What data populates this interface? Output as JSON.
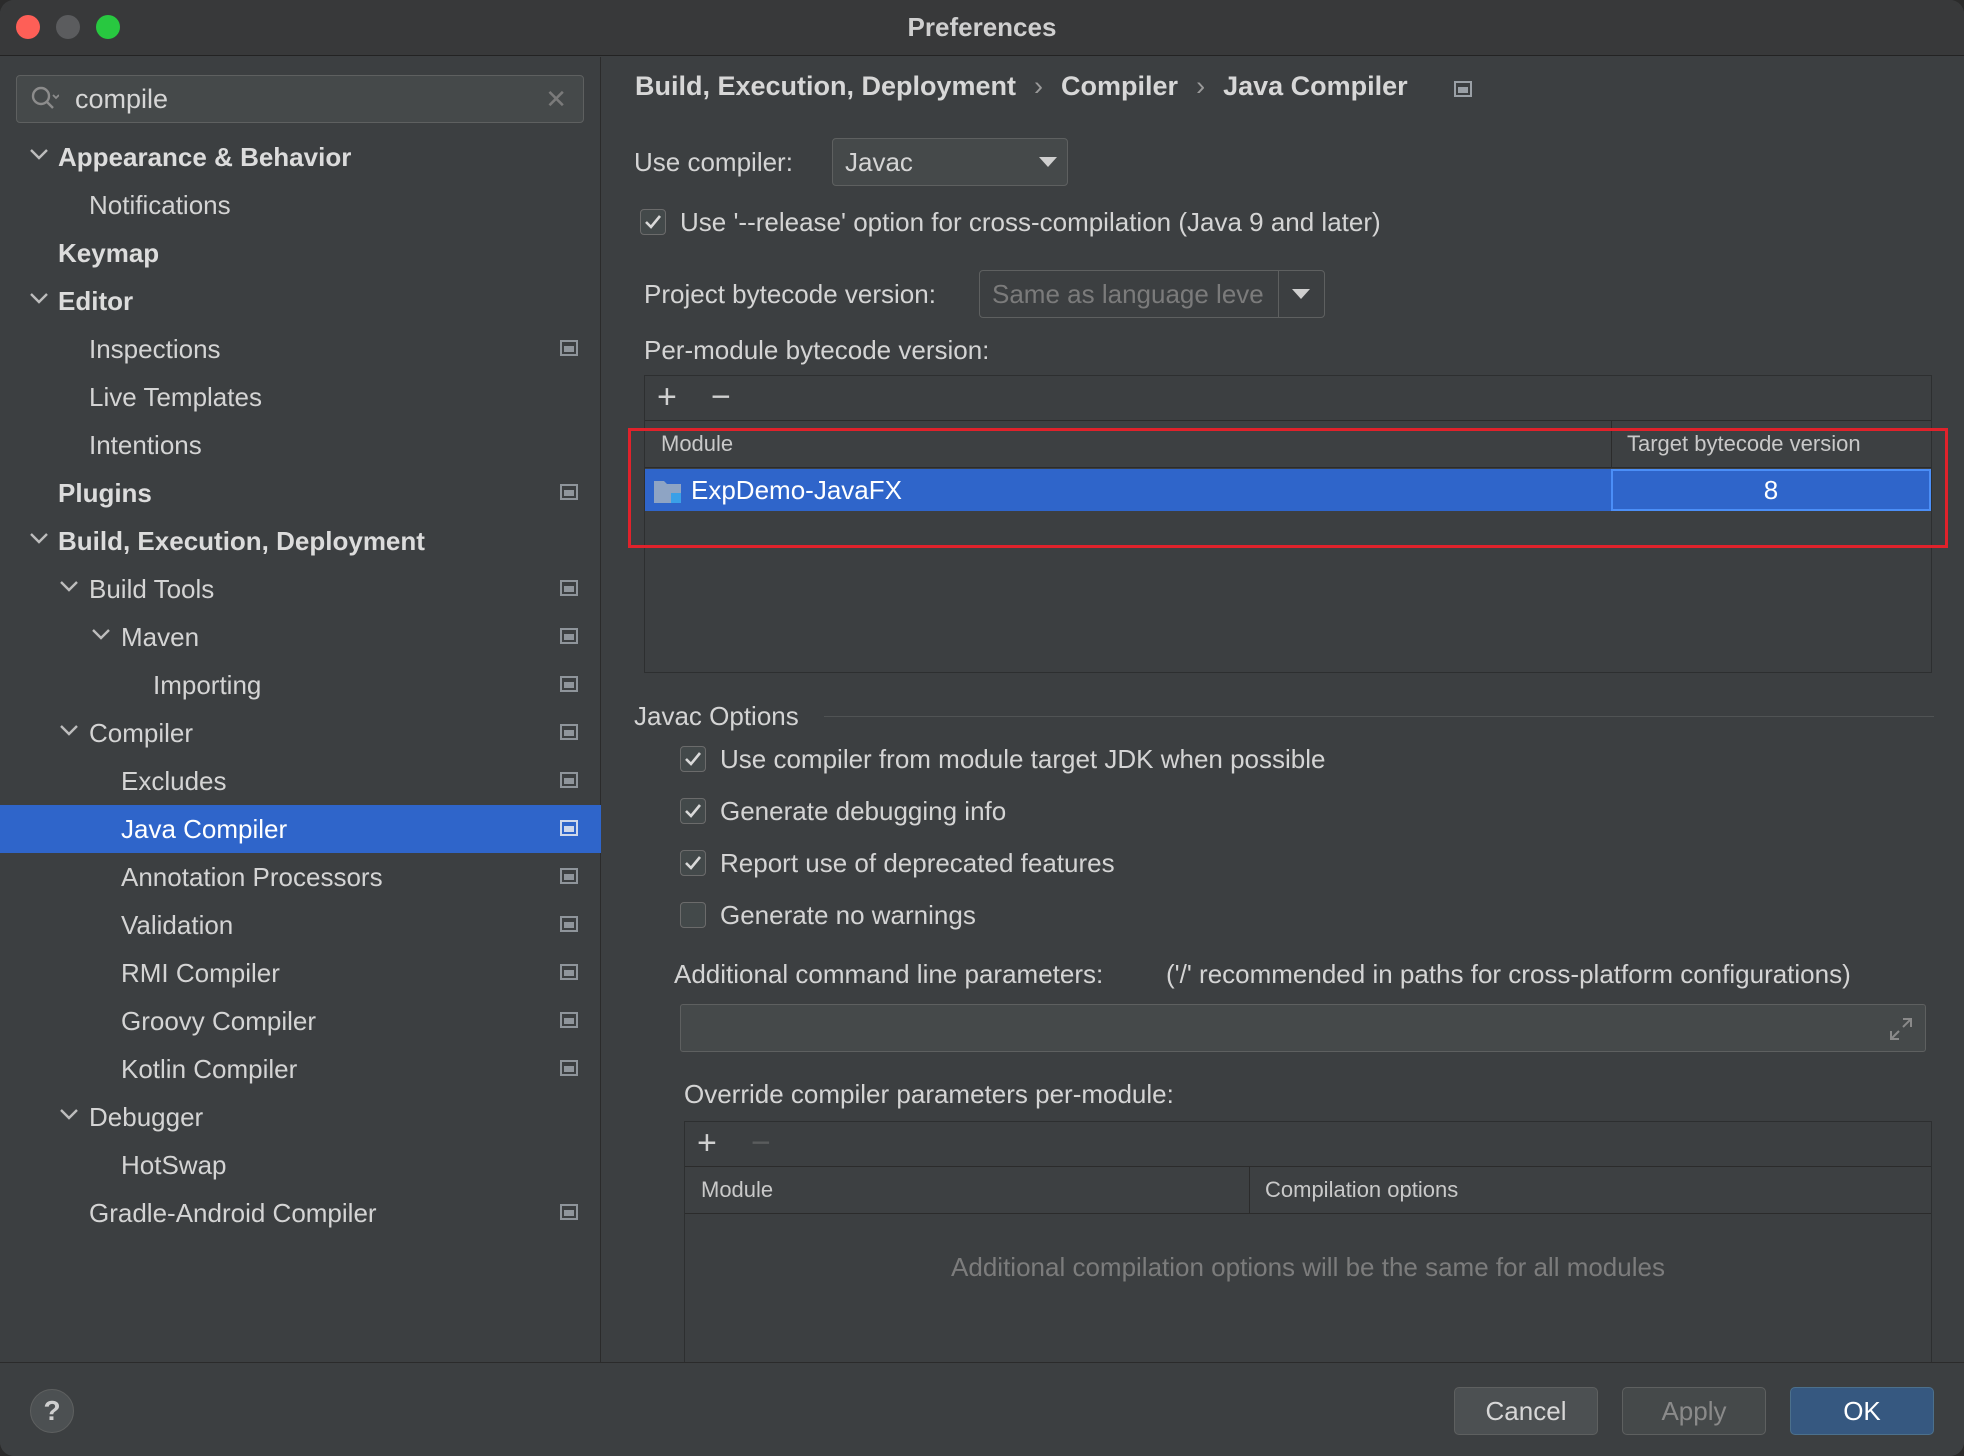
{
  "window": {
    "title": "Preferences"
  },
  "search": {
    "value": "compile"
  },
  "sidebar": {
    "items": [
      {
        "label": "Appearance & Behavior",
        "bold": true,
        "level": 0,
        "expanded": true,
        "project": false
      },
      {
        "label": "Notifications",
        "bold": false,
        "level": 1,
        "project": false
      },
      {
        "label": "Keymap",
        "bold": true,
        "level": 0,
        "project": false
      },
      {
        "label": "Editor",
        "bold": true,
        "level": 0,
        "expanded": true,
        "project": false
      },
      {
        "label": "Inspections",
        "bold": false,
        "level": 1,
        "project": true
      },
      {
        "label": "Live Templates",
        "bold": false,
        "level": 1,
        "project": false
      },
      {
        "label": "Intentions",
        "bold": false,
        "level": 1,
        "project": false
      },
      {
        "label": "Plugins",
        "bold": true,
        "level": 0,
        "project": true
      },
      {
        "label": "Build, Execution, Deployment",
        "bold": true,
        "level": 0,
        "expanded": true,
        "project": false
      },
      {
        "label": "Build Tools",
        "bold": false,
        "level": 1,
        "expanded": true,
        "project": true
      },
      {
        "label": "Maven",
        "bold": false,
        "level": 2,
        "expanded": true,
        "project": true
      },
      {
        "label": "Importing",
        "bold": false,
        "level": 3,
        "project": true
      },
      {
        "label": "Compiler",
        "bold": false,
        "level": 1,
        "expanded": true,
        "project": true
      },
      {
        "label": "Excludes",
        "bold": false,
        "level": 2,
        "project": true
      },
      {
        "label": "Java Compiler",
        "bold": false,
        "level": 2,
        "project": true,
        "selected": true
      },
      {
        "label": "Annotation Processors",
        "bold": false,
        "level": 2,
        "project": true
      },
      {
        "label": "Validation",
        "bold": false,
        "level": 2,
        "project": true
      },
      {
        "label": "RMI Compiler",
        "bold": false,
        "level": 2,
        "project": true
      },
      {
        "label": "Groovy Compiler",
        "bold": false,
        "level": 2,
        "project": true
      },
      {
        "label": "Kotlin Compiler",
        "bold": false,
        "level": 2,
        "project": true
      },
      {
        "label": "Debugger",
        "bold": false,
        "level": 1,
        "expanded": true,
        "project": false
      },
      {
        "label": "HotSwap",
        "bold": false,
        "level": 2,
        "project": false
      },
      {
        "label": "Gradle-Android Compiler",
        "bold": false,
        "level": 1,
        "project": true
      }
    ]
  },
  "breadcrumb": {
    "part1": "Build, Execution, Deployment",
    "part2": "Compiler",
    "part3": "Java Compiler",
    "separator": "›"
  },
  "compiler": {
    "use_compiler_label": "Use compiler:",
    "use_compiler_value": "Javac",
    "release_option_label": "Use '--release' option for cross-compilation (Java 9 and later)",
    "release_option_checked": true,
    "project_bytecode_label": "Project bytecode version:",
    "project_bytecode_value": "Same as language leve",
    "per_module_label": "Per-module bytecode version:",
    "module_table": {
      "columns": [
        "Module",
        "Target bytecode version"
      ],
      "rows": [
        {
          "module": "ExpDemo-JavaFX",
          "version": "8"
        }
      ]
    }
  },
  "javac_options": {
    "title": "Javac Options",
    "options": [
      {
        "label": "Use compiler from module target JDK when possible",
        "checked": true
      },
      {
        "label": "Generate debugging info",
        "checked": true
      },
      {
        "label": "Report use of deprecated features",
        "checked": true
      },
      {
        "label": "Generate no warnings",
        "checked": false
      }
    ],
    "additional_params_label": "Additional command line parameters:",
    "additional_params_hint": "('/' recommended in paths for cross-platform configurations)",
    "additional_params_value": "",
    "override_label": "Override compiler parameters per-module:",
    "override_table": {
      "columns": [
        "Module",
        "Compilation options"
      ],
      "empty_text": "Additional compilation options will be the same for all modules"
    }
  },
  "footer": {
    "help": "?",
    "cancel": "Cancel",
    "apply": "Apply",
    "ok": "OK"
  },
  "toolbar": {
    "add": "+",
    "remove": "−"
  },
  "colors": {
    "selection": "#2f65ca",
    "highlight": "#e0222b",
    "primary_button": "#365880"
  }
}
